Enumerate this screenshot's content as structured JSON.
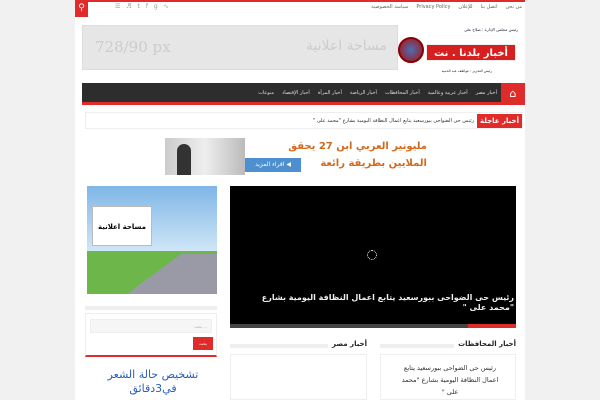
{
  "topbar": {
    "links": [
      "من نحن",
      "اتصل بنا",
      "للإعلان",
      "Privacy Policy",
      "سياسة الخصوصية"
    ],
    "social_icons": [
      "rss-icon",
      "google-plus-icon",
      "facebook-icon",
      "twitter-icon",
      "youtube-icon"
    ]
  },
  "header": {
    "logo_text": "أخبار بلدنا . نت",
    "chairman": "رئيس مجلس الإدارة : صلاح علي",
    "editor": "رئيس التحرير : عواطف عبد الحميد",
    "ad_size": "728/90 px",
    "ad_label": "مساحة اعلانية"
  },
  "nav": {
    "items": [
      "أخبار مصر",
      "أخبار عربية وعالمية",
      "أخبار المحافظات",
      "أخبار الرياضة",
      "أخبار المرأة",
      "أخبار الإقتصاد",
      "منوعات"
    ]
  },
  "breaking": {
    "label": "أخبار عاجلة",
    "text": "رئيس حى الضواحى ببورسعيد يتابع اعمال النظافة اليومية بشارع \"محمد على \""
  },
  "ad2": {
    "headline": "مليونير العربي ابن 27 يحقق الملايين بطريقة رائعة",
    "button": "اقراء المزيد ◀"
  },
  "sidebar": {
    "ad_label": "مساحة اعلانية",
    "search_placeholder": "بحث ...",
    "search_button": "بحث",
    "ad_text": "تشخيص حالة الشعر في3دقائق"
  },
  "slider": {
    "caption": "رئيس حى الضواحى ببورسعيد يتابع اعمال النظافة اليومية بشارع \"محمد على \""
  },
  "sections": [
    {
      "title": "أخبار المحافظات",
      "item": "رئيس حى الضواحى ببورسعيد يتابع اعمال النظافة اليومية بشارع \"محمد على \""
    },
    {
      "title": "أخبار مصر"
    }
  ]
}
